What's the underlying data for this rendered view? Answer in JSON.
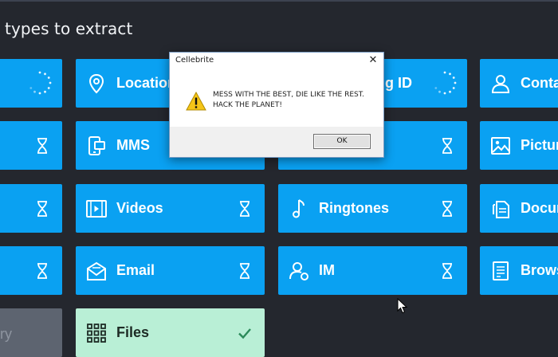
{
  "heading": "types to extract",
  "tiles": [
    {
      "label": "Location"
    },
    {
      "label": "g ID"
    },
    {
      "label": "Conta"
    },
    {
      "label": "MMS"
    },
    {
      "label": "Pictur"
    },
    {
      "label": "Videos"
    },
    {
      "label": "Ringtones"
    },
    {
      "label": "Docur"
    },
    {
      "label": "Email"
    },
    {
      "label": "IM"
    },
    {
      "label": "Brows"
    },
    {
      "label": "ry"
    },
    {
      "label": "Files"
    }
  ],
  "dialog": {
    "title": "Cellebrite",
    "close": "✕",
    "message_line1": "MESS WITH THE BEST, DIE LIKE THE REST.",
    "message_line2": "HACK THE PLANET!",
    "ok_label": "OK"
  },
  "colors": {
    "background": "#24272e",
    "tile": "#0aa1f2",
    "tile_selected": "#b9efd6",
    "tile_disabled": "#5d6470"
  }
}
